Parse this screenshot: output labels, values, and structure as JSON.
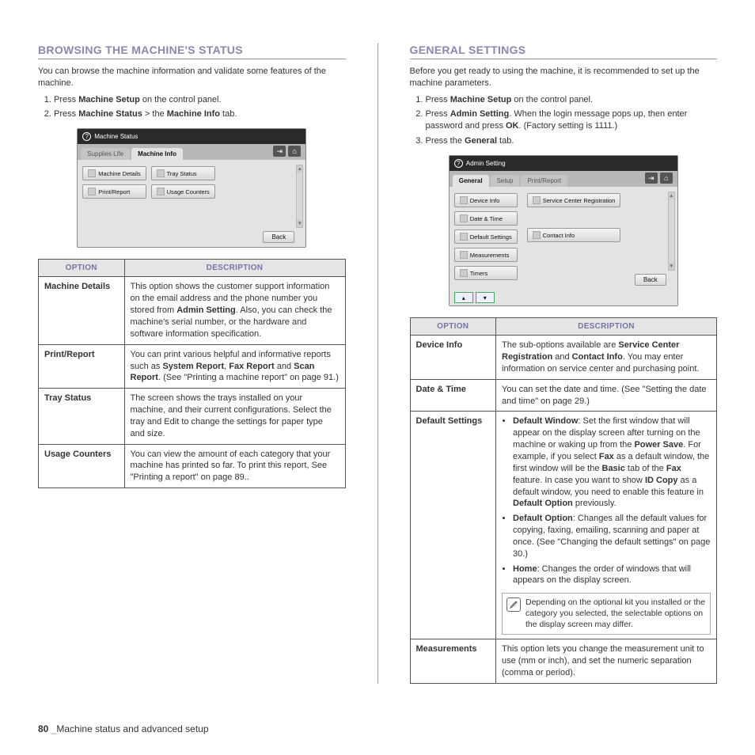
{
  "left": {
    "heading": "BROWSING THE MACHINE'S STATUS",
    "intro": "You can browse the machine information and validate some features of the machine.",
    "steps": [
      {
        "pre": "Press ",
        "b1": "Machine Setup",
        "post": " on the control panel."
      },
      {
        "pre": "Press ",
        "b1": "Machine Status",
        "mid": " > the ",
        "b2": "Machine Info",
        "post": " tab."
      }
    ],
    "ui": {
      "title": "Machine Status",
      "tab1": "Supplies Life",
      "tab2": "Machine Info",
      "btn1": "Machine Details",
      "btn2": "Tray Status",
      "btn3": "Print/Report",
      "btn4": "Usage Counters",
      "back": "Back"
    },
    "table": {
      "h1": "OPTION",
      "h2": "DESCRIPTION",
      "rows": [
        {
          "opt": "Machine Details",
          "desc": "This option shows the customer support information on the email address and the phone number you stored from <b>Admin Setting</b>. Also, you can check the machine's serial number, or the hardware and software information specification."
        },
        {
          "opt": "Print/Report",
          "desc": "You can print various helpful and informative reports such as <b>System Report</b>, <b>Fax Report</b> and <b>Scan Report</b>. (See \"Printing a machine report\" on page 91.)"
        },
        {
          "opt": "Tray Status",
          "desc": "The screen shows the trays installed on your machine, and their current configurations. Select the tray and Edit to change the settings for paper type and size."
        },
        {
          "opt": "Usage Counters",
          "desc": "You can view the amount of each category that your machine has printed so far. To print this report, See \"Printing a report\" on page 89.."
        }
      ]
    }
  },
  "right": {
    "heading": "GENERAL SETTINGS",
    "intro": "Before you get ready to using the machine, it is recommended to set up the machine parameters.",
    "steps": [
      {
        "pre": "Press ",
        "b1": "Machine Setup",
        "post": " on the control panel."
      },
      {
        "pre": "Press ",
        "b1": "Admin Setting",
        "post2": ". When the login message pops up, then enter password and press ",
        "b2": "OK",
        "post3": ". (Factory setting is 1111.)"
      },
      {
        "pre": "Press the ",
        "b1": "General",
        "post": " tab."
      }
    ],
    "ui": {
      "title": "Admin Setting",
      "tab1": "General",
      "tab2": "Setup",
      "tab3": "Print/Report",
      "side1": "Device Info",
      "side2": "Date & Time",
      "side3": "Default Settings",
      "side4": "Measurements",
      "side5": "Timers",
      "opt1": "Service Center Registration",
      "opt2": "Contact Info",
      "back": "Back"
    },
    "table": {
      "h1": "OPTION",
      "h2": "DESCRIPTION",
      "rows": [
        {
          "opt": "Device Info",
          "desc": "The sub-options available are <b>Service Center Registration</b> and <b>Contact Info</b>. You may enter information on service center and purchasing point."
        },
        {
          "opt": "Date & Time",
          "desc": "You can set the date and time. (See \"Setting the date and time\" on page 29.)"
        },
        {
          "opt": "Default Settings",
          "special": "bullets"
        },
        {
          "opt": "Measurements",
          "desc": "This option lets you change the measurement unit to use (mm or inch), and set the numeric separation (comma or period)."
        }
      ],
      "bullets": {
        "b1_pre": "Default Window",
        "b1_txt": ": Set the first window that will appear on the display screen after turning on the machine or waking up from the <b>Power Save</b>. For example, if you select <b>Fax</b> as a default window, the first window will be the <b>Basic</b> tab of the <b>Fax</b> feature. In case you want to show <b>ID Copy</b> as a default window, you need to enable this feature in <b>Default Option</b> previously.",
        "b2_pre": "Default Option",
        "b2_txt": ": Changes all the default values for copying, faxing, emailing, scanning and paper at once. (See \"Changing the default settings\" on page 30.)",
        "b3_pre": "Home",
        "b3_txt": ": Changes the order of windows that will appears on the display screen.",
        "note": "Depending on the optional kit you installed or the category you selected, the selectable options on the display screen may differ."
      }
    }
  },
  "footer": {
    "page": "80",
    "sep": "_",
    "title": "Machine status and advanced setup"
  }
}
